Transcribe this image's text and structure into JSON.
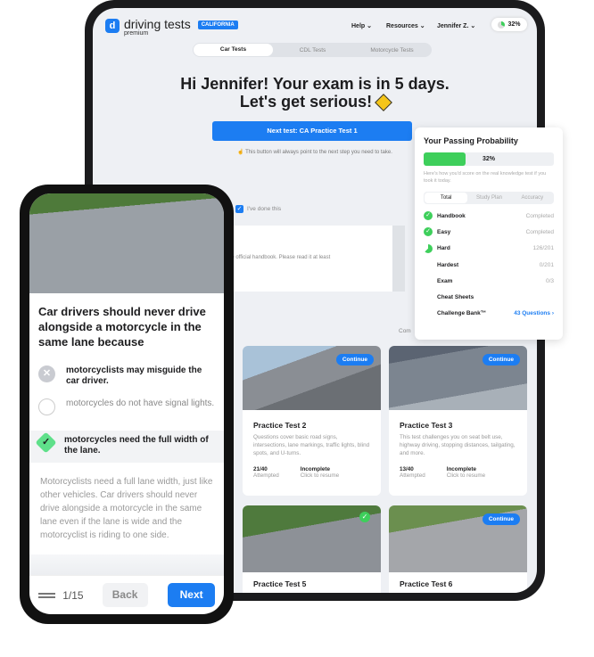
{
  "header": {
    "brand": "driving tests",
    "brand_sub": "premium",
    "state_badge": "CALIFORNIA",
    "nav": [
      "Help ⌄",
      "Resources ⌄",
      "Jennifer Z. ⌄"
    ],
    "progress_pill": "32%"
  },
  "tabs": [
    "Car Tests",
    "CDL Tests",
    "Motorcycle Tests"
  ],
  "hero": {
    "line1": "Hi Jennifer! Your exam is in 5 days.",
    "line2": "Let's get serious!"
  },
  "cta": {
    "label": "Next test: CA Practice Test 1",
    "hint": "☝ This button will always point to the next step you need to take."
  },
  "handbook": {
    "checkbox_label": "I've done this",
    "checked": true,
    "text": "he official handbook. Please read it at least",
    "partial": "Com"
  },
  "cards": [
    {
      "title": "Practice Test 2",
      "desc": "Questions cover basic road signs, intersections, lane markings, traffic lights, blind spots, and U-turns.",
      "progress": "21/40",
      "progress_label": "Attempted",
      "status": "Incomplete",
      "status_label": "Click to resume",
      "badge": "Continue"
    },
    {
      "title": "Practice Test 3",
      "desc": "This test challenges you on seat belt use, highway driving, stopping distances, tailgating, and more.",
      "progress": "13/40",
      "progress_label": "Attempted",
      "status": "Incomplete",
      "status_label": "Click to resume",
      "badge": "Continue"
    },
    {
      "title": "Practice Test 5",
      "completed": true
    },
    {
      "title": "Practice Test 6",
      "badge": "Continue"
    }
  ],
  "probability": {
    "title": "Your Passing Probability",
    "value": "32%",
    "fraction": 0.32,
    "note": "Here's how you'd score on the real knowledge test if you took it today.",
    "tabs": [
      "Total",
      "Study Plan",
      "Accuracy"
    ],
    "rows": [
      {
        "name": "Handbook",
        "value": "Completed",
        "state": "done"
      },
      {
        "name": "Easy",
        "value": "Completed",
        "state": "done"
      },
      {
        "name": "Hard",
        "value": "126/201",
        "state": "partial"
      },
      {
        "name": "Hardest",
        "value": "0/201",
        "state": "none"
      },
      {
        "name": "Exam",
        "value": "0/3",
        "state": "none"
      },
      {
        "name": "Cheat Sheets",
        "value": "",
        "state": "none"
      },
      {
        "name": "Challenge Bank™",
        "value": "43 Questions ›",
        "state": "none"
      }
    ]
  },
  "colors": {
    "accent": "#1c7df2",
    "success": "#3ecf5b"
  },
  "phone": {
    "question": "Car drivers should never drive alongside a motorcycle in the same lane because",
    "options": [
      {
        "text": "motorcyclists may misguide the car driver.",
        "state": "wrong"
      },
      {
        "text": "motorcycles do not have signal lights.",
        "state": "neutral"
      },
      {
        "text": "motorcycles need the full width of the lane.",
        "state": "correct"
      }
    ],
    "explanation": "Motorcyclists need a full lane width, just like other vehicles. Car drivers should never drive alongside a motorcycle in the same lane even if the lane is wide and the motorcyclist is riding to one side.",
    "counter": "1/15",
    "back": "Back",
    "next": "Next"
  }
}
